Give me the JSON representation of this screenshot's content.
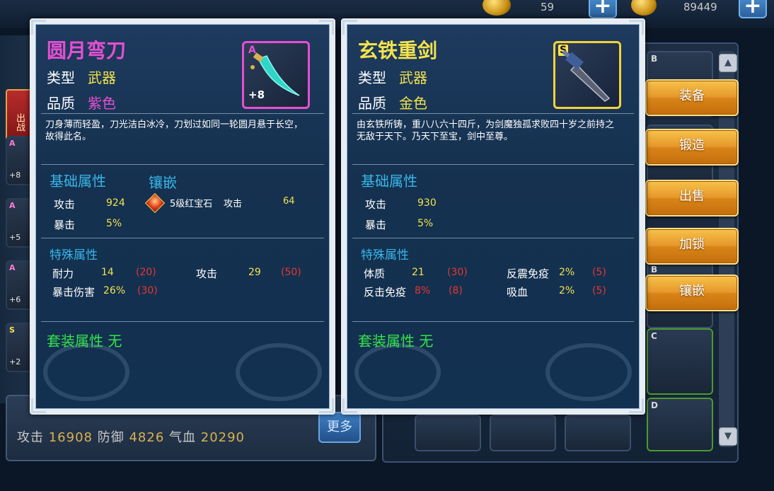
{
  "top_bar": {
    "resource1_value": "59",
    "resource2_value": "89449",
    "plus_symbol": "+"
  },
  "left_panel": {
    "tab_label": "出战",
    "slots": [
      {
        "quality": "A",
        "level": "+8"
      },
      {
        "quality": "A",
        "level": "+5"
      },
      {
        "quality": "A",
        "level": "+6"
      },
      {
        "quality": "S",
        "level": "+2"
      }
    ]
  },
  "bottom_stats": {
    "attack_label": "攻击",
    "attack_value": "16908",
    "defense_label": "防御",
    "defense_value": "4826",
    "hp_label": "气血",
    "hp_value": "20290",
    "more_button": "更多"
  },
  "inventory": {
    "slot_grades": [
      "B",
      "B",
      "B",
      "C",
      "D"
    ]
  },
  "actions": {
    "equip": "装备",
    "forge": "锻造",
    "sell": "出售",
    "lock": "加锁",
    "inlay": "镶嵌"
  },
  "card_left": {
    "name": "圆月弯刀",
    "type_label": "类型",
    "type_value": "武器",
    "quality_label": "品质",
    "quality_value": "紫色",
    "icon_quality": "A",
    "icon_level": "+8",
    "description": "刀身薄而轻盈，刀光洁白冰冷，刀划过如同一轮圆月悬于长空，故得此名。",
    "base_title": "基础属性",
    "inlay_title": "镶嵌",
    "base_stats": [
      {
        "label": "攻击",
        "value": "924"
      },
      {
        "label": "暴击",
        "value": "5%"
      }
    ],
    "gem": {
      "name": "5级红宝石",
      "stat": "攻击",
      "value": "64"
    },
    "special_title": "特殊属性",
    "special_stats": [
      {
        "label": "耐力",
        "value": "14",
        "cap": "(20)"
      },
      {
        "label": "攻击",
        "value": "29",
        "cap": "(50)"
      },
      {
        "label": "暴击伤害",
        "value": "26%",
        "cap": "(30)"
      }
    ],
    "suit": "套装属性 无"
  },
  "card_right": {
    "name": "玄铁重剑",
    "type_label": "类型",
    "type_value": "武器",
    "quality_label": "品质",
    "quality_value": "金色",
    "icon_quality": "S",
    "description": "由玄铁所铸，重八八六十四斤，为剑魔独孤求败四十岁之前持之无敌于天下。乃天下至宝，剑中至尊。",
    "base_title": "基础属性",
    "base_stats": [
      {
        "label": "攻击",
        "value": "930"
      },
      {
        "label": "暴击",
        "value": "5%"
      }
    ],
    "special_title": "特殊属性",
    "special_stats": [
      {
        "label": "体质",
        "value": "21",
        "cap": "(30)"
      },
      {
        "label": "反震免疫",
        "value": "2%",
        "cap": "(5)"
      },
      {
        "label": "反击免疫",
        "value": "8%",
        "cap": "(8)"
      },
      {
        "label": "吸血",
        "value": "2%",
        "cap": "(5)"
      }
    ],
    "suit": "套装属性 无"
  },
  "colors": {
    "purple_quality": "#e64fd2",
    "gold_quality": "#f2e24d",
    "section_blue": "#37b6e8",
    "suit_green": "#35e24a",
    "cap_red": "#e8362e"
  }
}
